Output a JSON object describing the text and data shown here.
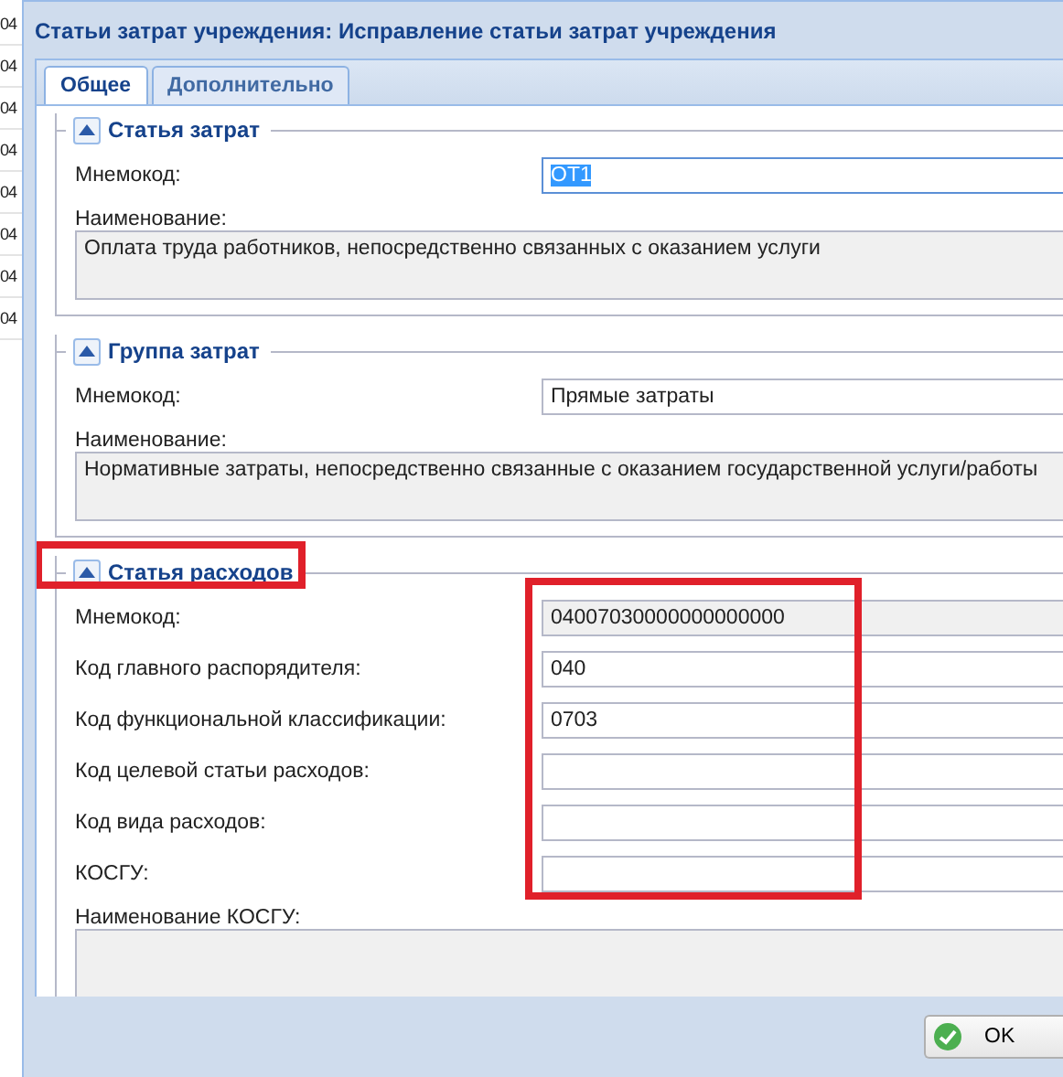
{
  "background_cells": [
    "04",
    "04",
    "04",
    "04",
    "04",
    "04",
    "04",
    "04"
  ],
  "window": {
    "title": "Статьи затрат учреждения: Исправление статьи затрат учреждения"
  },
  "tabs": [
    {
      "label": "Общее",
      "selected": true
    },
    {
      "label": "Дополнительно",
      "selected": false
    }
  ],
  "sections": [
    {
      "legend": "Статья затрат",
      "highlighted": false,
      "fields_highlighted": false,
      "fields": [
        {
          "kind": "row",
          "label": "Мнемокод:",
          "value": "ОТ1",
          "readonly": false,
          "focused": true
        },
        {
          "kind": "area",
          "label": "Наименование:",
          "value": "Оплата труда работников, непосредственно связанных с оказанием услуги",
          "readonly": true
        }
      ]
    },
    {
      "legend": "Группа затрат",
      "highlighted": false,
      "fields_highlighted": false,
      "fields": [
        {
          "kind": "row",
          "label": "Мнемокод:",
          "value": "Прямые затраты",
          "readonly": false,
          "focused": false
        },
        {
          "kind": "area",
          "label": "Наименование:",
          "value": "Нормативные затраты, непосредственно связанные с оказанием государственной услуги/работы",
          "readonly": true
        }
      ]
    },
    {
      "legend": "Статья расходов",
      "highlighted": true,
      "fields_highlighted": true,
      "fields": [
        {
          "kind": "row",
          "label": "Мнемокод:",
          "value": "04007030000000000000",
          "readonly": true,
          "focused": false
        },
        {
          "kind": "row",
          "label": "Код главного распорядителя:",
          "value": "040",
          "readonly": false,
          "focused": false
        },
        {
          "kind": "row",
          "label": "Код функциональной классификации:",
          "value": "0703",
          "readonly": false,
          "focused": false
        },
        {
          "kind": "row",
          "label": "Код целевой статьи расходов:",
          "readonly": false,
          "focused": false
        },
        {
          "kind": "row",
          "label": "Код вида расходов:",
          "readonly": false,
          "focused": false
        },
        {
          "kind": "row",
          "label": "КОСГУ:",
          "readonly": false,
          "focused": false
        },
        {
          "kind": "area",
          "label": "Наименование КОСГУ:",
          "readonly": true
        }
      ]
    }
  ],
  "buttons": [
    {
      "label": "OK"
    }
  ]
}
